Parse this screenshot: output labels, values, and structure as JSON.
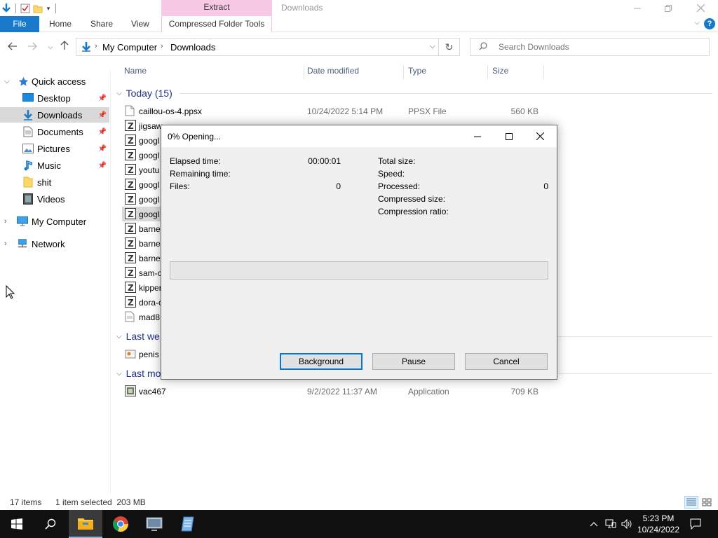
{
  "window": {
    "title": "Downloads",
    "context_tab": "Extract"
  },
  "ribbon": {
    "file": "File",
    "home": "Home",
    "share": "Share",
    "view": "View",
    "compressed_tools": "Compressed Folder Tools"
  },
  "address": {
    "crumbs": [
      "My Computer",
      "Downloads"
    ],
    "search_placeholder": "Search Downloads"
  },
  "sidebar": {
    "quick_access": "Quick access",
    "items": [
      {
        "label": "Desktop",
        "icon": "desktop-icon",
        "pinned": true
      },
      {
        "label": "Downloads",
        "icon": "downloads-icon",
        "pinned": true,
        "selected": true
      },
      {
        "label": "Documents",
        "icon": "documents-icon",
        "pinned": true
      },
      {
        "label": "Pictures",
        "icon": "pictures-icon",
        "pinned": true
      },
      {
        "label": "Music",
        "icon": "music-icon",
        "pinned": true
      },
      {
        "label": "shit",
        "icon": "folder-icon",
        "pinned": false
      },
      {
        "label": "Videos",
        "icon": "videos-icon",
        "pinned": false
      }
    ],
    "my_computer": "My Computer",
    "network": "Network"
  },
  "columns": {
    "name": "Name",
    "date": "Date modified",
    "type": "Type",
    "size": "Size"
  },
  "groups": {
    "today": "Today (15)",
    "last_week": "Last we",
    "last_month": "Last mo"
  },
  "today_files": [
    {
      "name": "caillou-os-4.ppsx",
      "date": "10/24/2022 5:14 PM",
      "type": "PPSX File",
      "size": "560 KB",
      "icon": "document-icon"
    },
    {
      "name": "jigsaw",
      "icon": "zip-icon"
    },
    {
      "name": "googl",
      "icon": "zip-icon"
    },
    {
      "name": "googl",
      "icon": "zip-icon"
    },
    {
      "name": "youtu",
      "icon": "zip-icon"
    },
    {
      "name": "googl",
      "icon": "zip-icon"
    },
    {
      "name": "googl",
      "icon": "zip-icon"
    },
    {
      "name": "googl",
      "icon": "zip-icon",
      "selected": true
    },
    {
      "name": "barne",
      "icon": "zip-icon"
    },
    {
      "name": "barne",
      "icon": "zip-icon"
    },
    {
      "name": "barne",
      "icon": "zip-icon"
    },
    {
      "name": "sam-c",
      "icon": "zip-icon"
    },
    {
      "name": "kipper",
      "icon": "zip-icon"
    },
    {
      "name": "dora-c",
      "icon": "zip-icon"
    },
    {
      "name": "mad8",
      "icon": "document-icon"
    }
  ],
  "last_week_files": [
    {
      "name": "penis",
      "icon": "setup-icon"
    }
  ],
  "last_month_files": [
    {
      "name": "vac467",
      "date": "9/2/2022 11:37 AM",
      "type": "Application",
      "size": "709 KB",
      "icon": "application-icon"
    }
  ],
  "status": {
    "items": "17 items",
    "selected": "1 item selected  203 MB"
  },
  "dialog": {
    "title": "0% Opening...",
    "elapsed_label": "Elapsed time:",
    "elapsed_value": "00:00:01",
    "remaining_label": "Remaining time:",
    "files_label": "Files:",
    "files_value": "0",
    "total_size_label": "Total size:",
    "speed_label": "Speed:",
    "processed_label": "Processed:",
    "processed_value": "0",
    "compressed_size_label": "Compressed size:",
    "compression_ratio_label": "Compression ratio:",
    "progress": 0,
    "background_button": "Background",
    "pause_button": "Pause",
    "cancel_button": "Cancel"
  },
  "taskbar": {
    "time": "5:23 PM",
    "date": "10/24/2022"
  },
  "colors": {
    "accent": "#1979ca",
    "context_tab": "#f7c9e4",
    "group_header": "#1e3287",
    "taskbar": "#101010"
  }
}
